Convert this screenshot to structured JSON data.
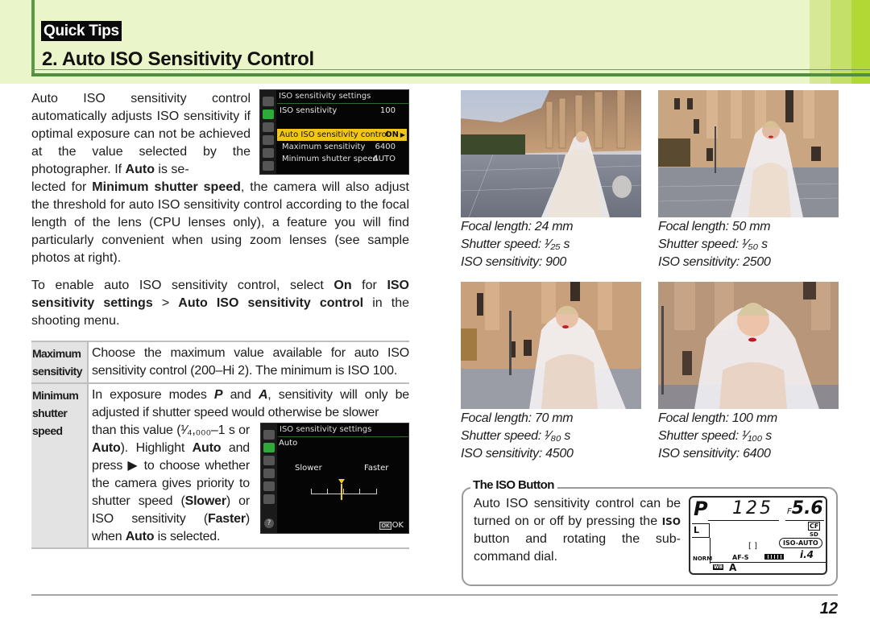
{
  "header": {
    "section_badge": "Quick Tips",
    "title": "2. Auto ISO Sensitivity Control",
    "colors": {
      "band": "#ebf5ca",
      "rule": "#4f8f3d",
      "accent": "#b2d835"
    }
  },
  "intro": {
    "p1_part1": "Auto ISO sensitivity control automatically adjusts ISO sensitivity if optimal exposure can not be achieved at the value selected by the photographer. If ",
    "p1_bold1": "Auto",
    "p1_part2": " is se-",
    "p1_cont1": "lected for ",
    "p1_bold2": "Minimum shutter speed",
    "p1_cont2": ", the camera will also adjust the threshold for auto ISO sensitivity control according to the focal length of the lens (CPU lenses only), a feature you will find particularly convenient when using zoom lenses (see sample photos at right).",
    "p2_part1": "To enable auto ISO sensitivity control, select ",
    "p2_bold1": "On",
    "p2_part2": " for ",
    "p2_bold2": "ISO sensitivity settings",
    "p2_part3": " > ",
    "p2_bold3": "Auto ISO sensitivity control",
    "p2_part4": " in the shooting menu."
  },
  "camera_menu_1": {
    "title": "ISO sensitivity settings",
    "rows": [
      {
        "label": "ISO sensitivity",
        "value": "100"
      },
      {
        "label": "Auto ISO sensitivity control",
        "value": "ON",
        "highlighted": true
      },
      {
        "label": "Maximum sensitivity",
        "value": "6400"
      },
      {
        "label": "Minimum shutter speed",
        "value": "AUTO"
      }
    ],
    "colors": {
      "highlight": "#f2c619",
      "active_tab": "#2eaa3a"
    }
  },
  "camera_menu_2": {
    "title": "ISO sensitivity settings",
    "mode": "Auto",
    "slower_label": "Slower",
    "faster_label": "Faster",
    "slider_position": 0.5,
    "help_label": "?",
    "ok_box": "OK",
    "ok_label": "OK"
  },
  "table": {
    "rows": [
      {
        "header": "Maximum sensitivity",
        "text": "Choose the maximum value available for auto ISO sensitivity control (200–Hi 2). The minimum is ISO 100."
      },
      {
        "header": "Minimum shutter speed",
        "text_part1": "In exposure modes ",
        "mode_p": "P",
        "text_part2": " and ",
        "mode_a": "A",
        "text_part3": ", sensitivity will only be adjusted if shutter speed would otherwise be slower",
        "text_part4": "than this value (¹⁄₄,₀₀₀–1 s or ",
        "bold_auto1": "Auto",
        "text_part5": "). Highlight ",
        "bold_auto2": "Auto",
        "text_part6": " and press ▶ to choose whether the camera gives priority to shutter speed (",
        "bold_slower": "Slower",
        "text_part7": ") or ISO sensitivity (",
        "bold_faster": "Faster",
        "text_part8": ") when ",
        "bold_auto3": "Auto",
        "text_part9": " is selected."
      }
    ]
  },
  "samples": [
    {
      "focal": "Focal length: 24 mm",
      "shutter": "Shutter speed: ¹⁄₂₅ s",
      "iso": "ISO sensitivity: 900"
    },
    {
      "focal": "Focal length: 50 mm",
      "shutter": "Shutter speed: ¹⁄₅₀ s",
      "iso": "ISO sensitivity: 2500"
    },
    {
      "focal": "Focal length: 70 mm",
      "shutter": "Shutter speed: ¹⁄₈₀ s",
      "iso": "ISO sensitivity: 4500"
    },
    {
      "focal": "Focal length: 100 mm",
      "shutter": "Shutter speed: ¹⁄₁₀₀ s",
      "iso": "ISO sensitivity: 6400"
    }
  ],
  "iso_button_box": {
    "title": "The ISO Button",
    "text_part1": "Auto ISO sensitivity control can be turned on or off by pressing the ",
    "iso_label": "ISO",
    "text_part2": " button and rotating the sub-command dial."
  },
  "lcd": {
    "mode": "P",
    "shutter": "125",
    "aperture_prefix": "F",
    "aperture": "5.6",
    "quality": "L",
    "norm": "NORM",
    "card": "CF",
    "sd": "SD",
    "af_area": "[ ]",
    "iso_auto": "ISO-AUTO",
    "af_mode": "AF-S",
    "remaining": "i.4",
    "wb_label": "WB",
    "wb_value": "A"
  },
  "footer": {
    "page_number": "12"
  }
}
